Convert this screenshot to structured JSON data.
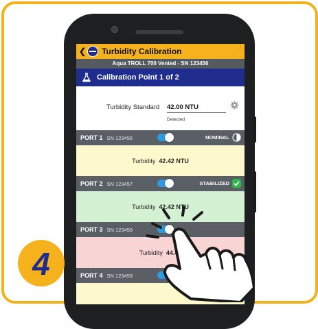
{
  "app": {
    "title": "Turbidity Calibration",
    "back_glyph": "❮",
    "menu_glyph": "⋮",
    "device": "Aqua TROLL 700 Vented - SN 123456"
  },
  "calibration": {
    "header": "Calibration Point 1 of 2",
    "standard_label": "Turbidity Standard",
    "standard_value": "42.00 NTU",
    "standard_sub": "Detected"
  },
  "ports": [
    {
      "name": "PORT 1",
      "sn": "SN 123456",
      "status": "NOMINAL",
      "status_icon": "half-circle-icon",
      "reading_label": "Turbidity",
      "reading_value": "42.42 NTU",
      "bg": "#fdf9cd"
    },
    {
      "name": "PORT 2",
      "sn": "SN 123457",
      "status": "STABILIZED",
      "status_icon": "check-icon",
      "reading_label": "Turbidity",
      "reading_value": "42.42 NTU",
      "bg": "#d5f1d3"
    },
    {
      "name": "PORT 3",
      "sn": "SN 123458",
      "status": "",
      "status_icon": "",
      "reading_label": "Turbidity",
      "reading_value": "44.42",
      "bg": "#f9d4d4"
    },
    {
      "name": "PORT 4",
      "sn": "SN 123459",
      "status": "",
      "status_icon": "",
      "reading_label": "",
      "reading_value": "",
      "bg": "#fdf9cd"
    }
  ],
  "step": {
    "number": "4"
  },
  "colors": {
    "accent": "#f5b21c",
    "header_blue": "#1f2d8f",
    "toggle_blue": "#2e9be0",
    "stabilized_green": "#2db84a"
  }
}
